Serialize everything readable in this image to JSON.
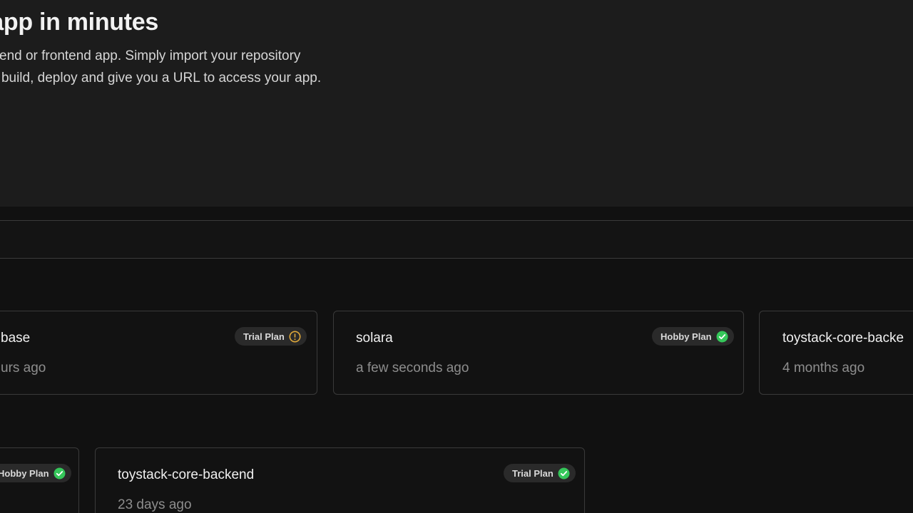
{
  "hero": {
    "title": "l app in minutes",
    "description_line1": "ckend or frontend app. Simply import your repository",
    "description_line2": "ill build, deploy and give you a URL to access your app."
  },
  "search": {
    "placeholder": ""
  },
  "projects": [
    {
      "name": "base",
      "time": "urs ago",
      "plan": "Trial Plan",
      "status_icon": "warning-circle-icon"
    },
    {
      "name": "solara",
      "time": "a few seconds ago",
      "plan": "Hobby Plan",
      "status_icon": "check-circle-icon"
    },
    {
      "name": "toystack-core-backe",
      "time": "4 months ago",
      "plan": "",
      "status_icon": ""
    },
    {
      "name": "",
      "time": "",
      "plan": "Hobby Plan",
      "status_icon": "check-circle-icon"
    },
    {
      "name": "toystack-core-backend",
      "time": "23 days ago",
      "plan": "Trial Plan",
      "status_icon": "check-circle-icon"
    }
  ],
  "colors": {
    "background": "#111111",
    "hero_background": "#1c1c1c",
    "badge_background": "#2a2a2a",
    "success_green": "#35c75a",
    "warning_amber": "#e0a93a"
  }
}
